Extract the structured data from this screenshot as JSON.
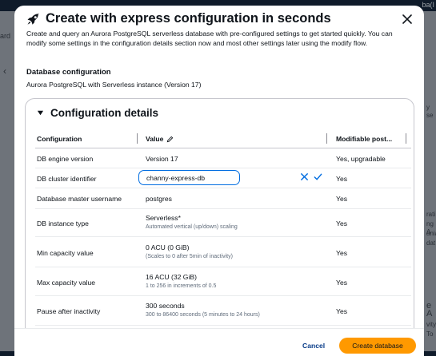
{
  "background": {
    "topbar_left": "",
    "topbar_right": "ba(I",
    "side_text": "ard",
    "right_texts": [
      "y se",
      "rati",
      "ng A",
      "ania",
      "dat",
      "e A",
      "vity",
      "To"
    ]
  },
  "modal": {
    "title": "Create with express configuration in seconds",
    "description": "Create and query an Aurora PostgreSQL serverless database with pre-configured settings to get started quickly. You can modify some settings in the configuration details section now and most other settings later using the modify flow.",
    "db_config_heading": "Database configuration",
    "db_config_value": "Aurora PostgreSQL with Serverless instance (Version 17)"
  },
  "details": {
    "heading": "Configuration details",
    "columns": [
      "Configuration",
      "Value",
      "Modifiable post..."
    ],
    "rows": [
      {
        "config": "DB engine version",
        "value": "Version 17",
        "sub": "",
        "modifiable": "Yes, upgradable"
      },
      {
        "config": "DB cluster identifier",
        "value": "channy-express-db",
        "sub": "",
        "modifiable": "Yes"
      },
      {
        "config": "Database master username",
        "value": "postgres",
        "sub": "",
        "modifiable": "Yes"
      },
      {
        "config": "DB instance type",
        "value": "Serverless*",
        "sub": "Automated vertical (up/down) scaling",
        "modifiable": "Yes"
      },
      {
        "config": "Min capacity value",
        "value": "0 ACU (0 GiB)",
        "sub": "(Scales to 0 after 5min of inactivity)",
        "modifiable": "Yes"
      },
      {
        "config": "Max capacity value",
        "value": "16 ACU (32 GiB)",
        "sub": "1 to 256 in increments of 0.5",
        "modifiable": "Yes"
      },
      {
        "config": "Pause after inactivity",
        "value": "300 seconds",
        "sub": "300 to 86400 seconds (5 minutes to 24 hours)",
        "modifiable": "Yes"
      }
    ]
  },
  "footer": {
    "cancel_label": "Cancel",
    "create_label": "Create database"
  },
  "colors": {
    "accent": "#ff9900",
    "link": "#0b3e8a",
    "focus": "#006ce0"
  }
}
